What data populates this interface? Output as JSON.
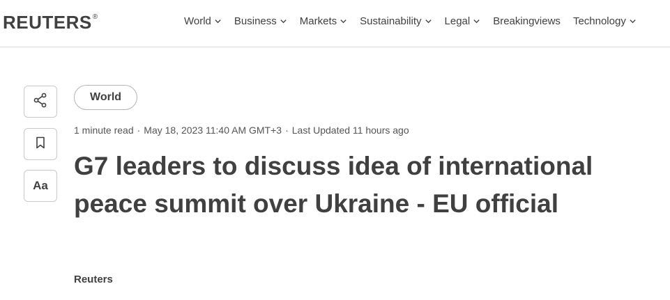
{
  "brand": {
    "logo_text": "REUTERS",
    "logo_mark": "®"
  },
  "nav": {
    "items": [
      {
        "label": "World",
        "has_dropdown": true
      },
      {
        "label": "Business",
        "has_dropdown": true
      },
      {
        "label": "Markets",
        "has_dropdown": true
      },
      {
        "label": "Sustainability",
        "has_dropdown": true
      },
      {
        "label": "Legal",
        "has_dropdown": true
      },
      {
        "label": "Breakingviews",
        "has_dropdown": false
      },
      {
        "label": "Technology",
        "has_dropdown": true
      }
    ]
  },
  "tools": {
    "share_icon": "share-icon",
    "bookmark_icon": "bookmark-icon",
    "font_size_label": "Aa"
  },
  "article": {
    "section": "World",
    "read_time": "1 minute read",
    "published": "May 18, 2023 11:40 AM GMT+3",
    "updated": "Last Updated 11 hours ago",
    "separator": "·",
    "title": "G7 leaders to discuss idea of international peace summit over Ukraine - EU official",
    "byline": "Reuters"
  },
  "colors": {
    "text": "#404040",
    "border": "#c9c9c9",
    "divider": "#dcdcdc"
  }
}
